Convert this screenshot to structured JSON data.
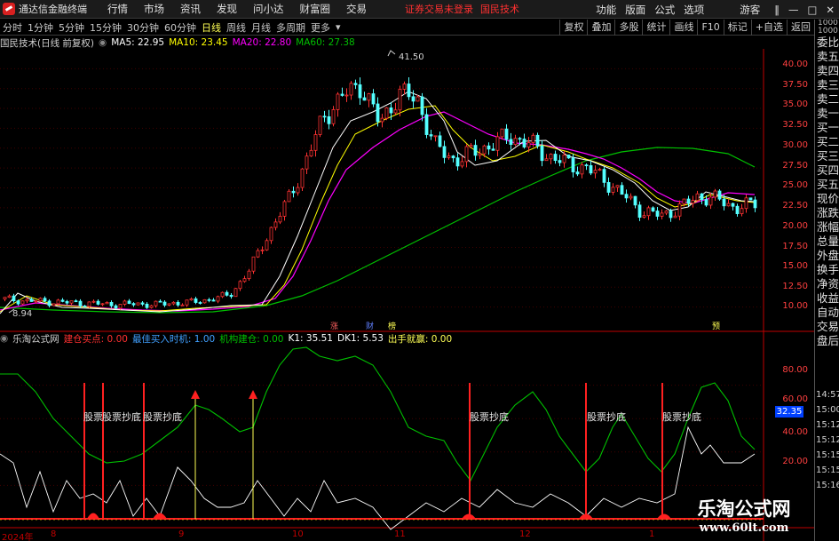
{
  "titlebar": {
    "app_title": "通达信金融终端",
    "menu": [
      "行情",
      "市场",
      "资讯",
      "发现",
      "问小达",
      "财富圈",
      "交易"
    ],
    "status": "证券交易未登录",
    "broker": "国民技术",
    "right_menu": [
      "功能",
      "版面",
      "公式",
      "选项"
    ],
    "guest": "游客",
    "window_buttons": [
      "‖",
      "—",
      "□",
      "✕"
    ]
  },
  "periodbar": {
    "periods": [
      "分时",
      "1分钟",
      "5分钟",
      "15分钟",
      "30分钟",
      "60分钟",
      "日线",
      "周线",
      "月线",
      "多周期",
      "更多"
    ],
    "active_period": "日线",
    "tools": [
      "复权",
      "叠加",
      "多股",
      "统计",
      "画线",
      "F10",
      "标记",
      "+自选",
      "返回"
    ]
  },
  "main_legend": {
    "title": "国民技术(日线 前复权)",
    "ma5": "MA5: 22.95",
    "ma10": "MA10: 23.45",
    "ma20": "MA20: 22.80",
    "ma60": "MA60: 27.38",
    "colors": {
      "ma5": "#ffffff",
      "ma10": "#ffff00",
      "ma20": "#ff00ff",
      "ma60": "#00c000"
    }
  },
  "sub_legend": {
    "title": "乐淘公式网",
    "items": [
      {
        "text": "建仓买点: 0.00",
        "color": "#ff3030"
      },
      {
        "text": "最佳买入时机: 1.00",
        "color": "#40a0ff"
      },
      {
        "text": "机构建仓: 0.00",
        "color": "#00c000"
      },
      {
        "text": "K1: 35.51",
        "color": "#ffffff"
      },
      {
        "text": "DK1: 5.53",
        "color": "#ffffff"
      },
      {
        "text": "出手就赢: 0.00",
        "color": "#ffff55"
      }
    ]
  },
  "quote_col": {
    "header_small": [
      "1000",
      "1000"
    ],
    "labels": [
      "委比",
      "卖五",
      "卖四",
      "卖三",
      "卖二",
      "卖一",
      "买一",
      "买二",
      "买三",
      "买四",
      "买五",
      "现价",
      "涨跌",
      "涨幅",
      "总量",
      "外盘",
      "换手",
      "净资",
      "收益",
      "自动",
      "交易",
      "盘后"
    ],
    "times": [
      "14:57",
      "15:00",
      "15:12",
      "15:12",
      "15:15",
      "15:15",
      "15:16"
    ]
  },
  "annotations": {
    "high_mark": "41.50",
    "low_mark": "8.94",
    "bottom_signal": "股票抄底",
    "overlap_signal": "股票",
    "sub_value": "32.35",
    "event_flags": [
      "涨",
      "财",
      "榜",
      "预"
    ]
  },
  "watermark": {
    "line1": "乐淘公式网",
    "line2": "www.60lt.com"
  },
  "chart_data": [
    {
      "type": "candlestick",
      "title": "国民技术(日线 前复权)",
      "ylabel": "",
      "y_ticks": [
        10.0,
        12.5,
        15.0,
        17.5,
        20.0,
        22.5,
        25.0,
        27.5,
        30.0,
        32.5,
        35.0,
        37.5,
        40.0
      ],
      "ylim": [
        8.5,
        42.5
      ],
      "x_ticks": [
        "2024年",
        "8",
        "9",
        "10",
        "11",
        "12",
        "1"
      ],
      "period_high": 41.5,
      "period_low": 8.94,
      "last_ma": {
        "MA5": 22.95,
        "MA10": 23.45,
        "MA20": 22.8,
        "MA60": 27.38
      },
      "series": [
        {
          "name": "K线",
          "approx_close_path": [
            11.0,
            10.8,
            10.7,
            10.6,
            10.5,
            10.4,
            10.3,
            10.4,
            10.3,
            10.5,
            10.6,
            11.0,
            11.5,
            14.5,
            19.0,
            23.0,
            28.0,
            34.0,
            36.5,
            38.0,
            33.0,
            37.0,
            36.0,
            30.0,
            28.5,
            29.5,
            30.5,
            31.5,
            30.5,
            29.0,
            28.0,
            27.5,
            26.0,
            24.0,
            22.0,
            21.5,
            22.5,
            24.0,
            23.5,
            22.5,
            23.0
          ]
        }
      ]
    },
    {
      "type": "line",
      "title": "乐淘公式网",
      "y_ticks": [
        20.0,
        40.0,
        60.0,
        80.0
      ],
      "ylim": [
        0,
        100
      ],
      "series": [
        {
          "name": "K1",
          "last": 35.51
        },
        {
          "name": "DK1",
          "last": 5.53
        }
      ],
      "current_marker": 32.35
    }
  ]
}
